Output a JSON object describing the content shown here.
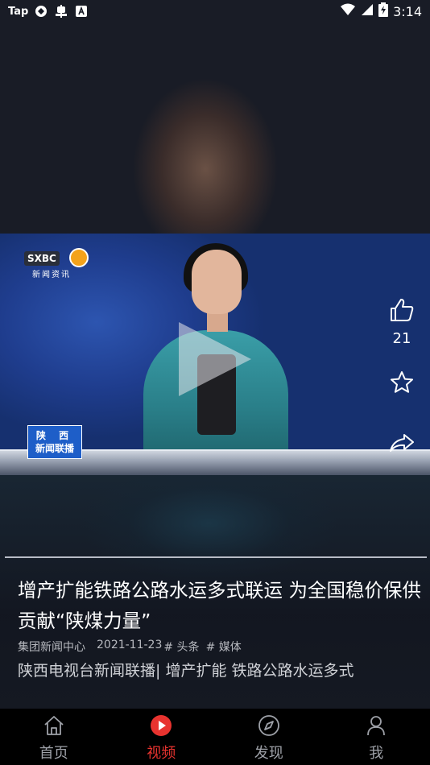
{
  "status_bar": {
    "left_icons": [
      "taptap-icon",
      "sync-icon",
      "bug-icon",
      "a-icon"
    ],
    "taptap_label": "Tap",
    "time": "3:14"
  },
  "video": {
    "channel_logo_text": "SXBC",
    "channel_logo_sub": "新闻资讯",
    "news_tag_line1": "陕 西",
    "news_tag_line2": "新闻联播"
  },
  "actions": {
    "like_count": "21"
  },
  "article": {
    "title": "增产扩能铁路公路水运多式联运 为全国稳价保供贡献“陕煤力量”",
    "source": "集团新闻中心",
    "date": "2021-11-23",
    "tag1": "# 头条",
    "tag2": "# 媒体",
    "description": "陕西电视台新闻联播| 增产扩能 铁路公路水运多式"
  },
  "tabbar": {
    "items": [
      {
        "label": "首页",
        "icon": "home-icon"
      },
      {
        "label": "视频",
        "icon": "play-circle-icon"
      },
      {
        "label": "发现",
        "icon": "compass-icon"
      },
      {
        "label": "我",
        "icon": "person-icon"
      }
    ],
    "active_index": 1,
    "active_color": "#e8332f"
  }
}
